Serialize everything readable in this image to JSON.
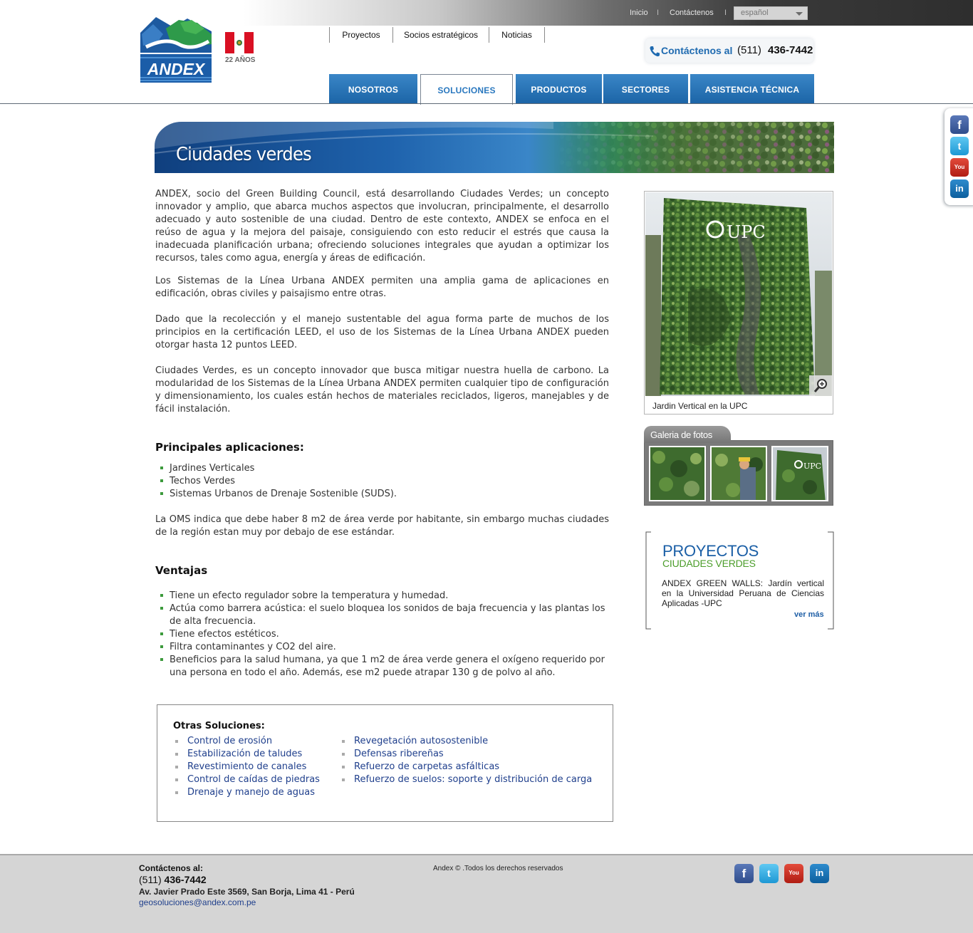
{
  "topbar": {
    "links": [
      "Inicio",
      "Contáctenos"
    ],
    "separator": "I",
    "language": "español"
  },
  "brand": {
    "logo_text": "ANDEX",
    "years_badge": "22 AÑOS"
  },
  "secondary_nav": [
    "Proyectos",
    "Socios estratégicos",
    "Noticias"
  ],
  "phone": {
    "label": "Contáctenos al",
    "prefix": "(511)",
    "number": "436-7442"
  },
  "main_nav": {
    "tabs": [
      "NOSOTROS",
      "SOLUCIONES",
      "PRODUCTOS",
      "SECTORES",
      "ASISTENCIA TÉCNICA"
    ],
    "active": "SOLUCIONES"
  },
  "social": [
    "facebook-icon",
    "twitter-icon",
    "youtube-icon",
    "linkedin-icon"
  ],
  "banner": {
    "title": "Ciudades verdes"
  },
  "content": {
    "paragraphs": [
      "ANDEX, socio del Green Building Council, está desarrollando Ciudades Verdes; un concepto innovador y amplio, que abarca muchos aspectos que involucran, principalmente, el desarrollo adecuado y auto sostenible de una  ciudad. Dentro de este contexto, ANDEX se enfoca en el reúso de agua y la mejora del paisaje, consiguiendo con esto reducir el estrés que causa la inadecuada planificación urbana; ofreciendo soluciones integrales que ayudan a optimizar los recursos, tales como agua, energía y áreas de edificación.",
      "Los Sistemas de la Línea Urbana ANDEX permiten una amplia gama de aplicaciones en edificación, obras civiles y paisajismo entre otras.",
      "Dado que la recolección y el manejo sustentable del agua forma parte de muchos de los principios en la certificación LEED, el uso de los Sistemas de la Línea Urbana ANDEX pueden otorgar hasta 12 puntos LEED.",
      "Ciudades Verdes, es un concepto innovador que busca mitigar nuestra huella de carbono. La modularidad de los Sistemas de la Línea Urbana ANDEX permiten cualquier tipo de configuración y dimensionamiento, los cuales están hechos de materiales reciclados, ligeros, manejables y de fácil instalación."
    ],
    "applications_heading": "Principales aplicaciones:",
    "applications": [
      "Jardines Verticales",
      "Techos Verdes",
      "Sistemas Urbanos de Drenaje Sostenible (SUDS)."
    ],
    "oms_paragraph": "La OMS indica que debe haber 8 m2 de área verde por habitante, sin embargo muchas ciudades de la región estan muy por debajo de ese estándar.",
    "advantages_heading": "Ventajas",
    "advantages": [
      "Tiene un efecto regulador sobre la temperatura y humedad.",
      "Actúa como barrera acústica: el suelo bloquea los sonidos de baja frecuencia y las plantas los de alta frecuencia.",
      "Tiene efectos estéticos.",
      "Filtra contaminantes y CO2 del aire.",
      "Beneficios para la salud humana, ya que 1 m2 de área verde genera el oxígeno requerido por una persona en todo el año. Además, ese m2 puede atrapar 130 g de polvo al año."
    ]
  },
  "other_solutions": {
    "heading": "Otras Soluciones:",
    "col1": [
      "Control de erosión",
      "Estabilización de taludes",
      "Revestimiento de canales",
      "Control de caídas de piedras",
      "Drenaje y manejo de aguas"
    ],
    "col2": [
      "Revegetación autosostenible",
      "Defensas ribereñas",
      "Refuerzo de carpetas asfálticas",
      "Refuerzo de suelos: soporte y distribución de carga"
    ]
  },
  "sidebar": {
    "photo_sign": "UPC",
    "photo_caption": "Jardin Vertical en la UPC",
    "gallery_title": "Galeria de fotos",
    "gallery_thumb_sign": "UPC",
    "projects": {
      "title": "PROYECTOS",
      "subtitle": "CIUDADES VERDES",
      "text": "ANDEX GREEN WALLS: Jardín vertical en la Universidad Peruana de Ciencias Aplicadas -UPC",
      "more": "ver más"
    }
  },
  "footer": {
    "contact_heading": "Contáctenos al:",
    "phone_prefix": "(511)",
    "phone_number": "436-7442",
    "address": "Av. Javier Prado Este 3569, San Borja, Lima 41 - Perú",
    "email": "geosoluciones@andex.com.pe",
    "copyright": "Andex © .Todos los derechos reservados"
  },
  "colors": {
    "brand_blue": "#1b64a6",
    "accent_green": "#4b9d2a",
    "footer_bg": "#d5d5d5"
  }
}
